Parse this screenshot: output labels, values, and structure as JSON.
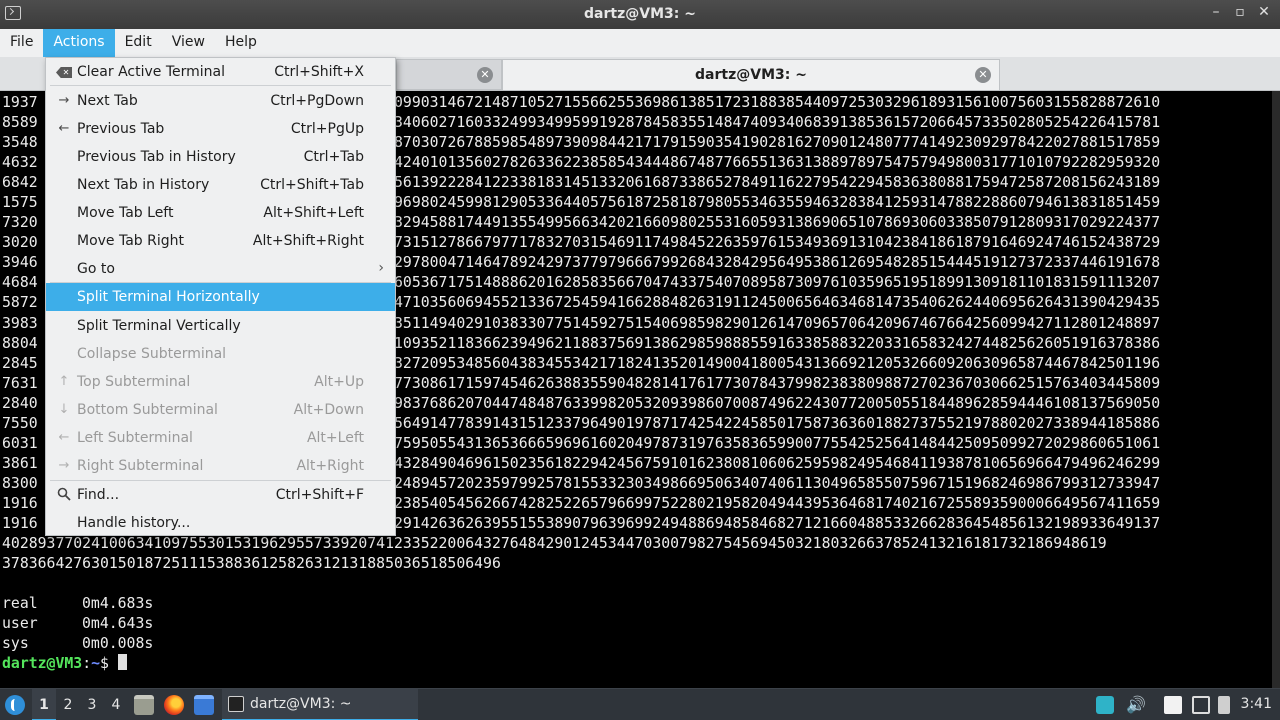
{
  "window": {
    "title": "dartz@VM3: ~",
    "buttons": [
      "–",
      "▫",
      "✕"
    ]
  },
  "menubar": {
    "items": [
      "File",
      "Actions",
      "Edit",
      "View",
      "Help"
    ],
    "active": "Actions"
  },
  "tabs": [
    {
      "label": "",
      "close": "✕"
    },
    {
      "label": "dartz@VM3: ~",
      "close": "✕"
    }
  ],
  "dropdown": {
    "items": [
      {
        "label": "Clear Active Terminal",
        "shortcut": "Ctrl+Shift+X",
        "icon": "clear-icon",
        "state": "normal"
      },
      {
        "label": "Next Tab",
        "shortcut": "Ctrl+PgDown",
        "icon": "arrow-right-icon",
        "state": "normal"
      },
      {
        "label": "Previous Tab",
        "shortcut": "Ctrl+PgUp",
        "icon": "arrow-left-icon",
        "state": "normal"
      },
      {
        "label": "Previous Tab in History",
        "shortcut": "Ctrl+Tab",
        "icon": "",
        "state": "normal"
      },
      {
        "label": "Next Tab in History",
        "shortcut": "Ctrl+Shift+Tab",
        "icon": "",
        "state": "normal"
      },
      {
        "label": "Move Tab Left",
        "shortcut": "Alt+Shift+Left",
        "icon": "",
        "state": "normal"
      },
      {
        "label": "Move Tab Right",
        "shortcut": "Alt+Shift+Right",
        "icon": "",
        "state": "normal"
      },
      {
        "label": "Go to",
        "shortcut": "",
        "icon": "",
        "state": "submenu"
      },
      {
        "label": "Split Terminal Horizontally",
        "shortcut": "",
        "icon": "",
        "state": "highlighted"
      },
      {
        "label": "Split Terminal Vertically",
        "shortcut": "",
        "icon": "",
        "state": "normal"
      },
      {
        "label": "Collapse Subterminal",
        "shortcut": "",
        "icon": "",
        "state": "disabled"
      },
      {
        "label": "Top Subterminal",
        "shortcut": "Alt+Up",
        "icon": "arrow-up-icon",
        "state": "disabled"
      },
      {
        "label": "Bottom Subterminal",
        "shortcut": "Alt+Down",
        "icon": "arrow-down-icon",
        "state": "disabled"
      },
      {
        "label": "Left Subterminal",
        "shortcut": "Alt+Left",
        "icon": "arrow-left-icon",
        "state": "disabled"
      },
      {
        "label": "Right Subterminal",
        "shortcut": "Alt+Right",
        "icon": "arrow-right-icon",
        "state": "disabled"
      },
      {
        "label": "Find...",
        "shortcut": "Ctrl+Shift+F",
        "icon": "search-icon",
        "state": "normal"
      },
      {
        "label": "Handle history...",
        "shortcut": "",
        "icon": "",
        "state": "normal"
      }
    ],
    "submenu_arrow": "›"
  },
  "terminal": {
    "left_digits": [
      "1937",
      "8589",
      "3548",
      "4632",
      "6842",
      "1575",
      "7320",
      "3020",
      "3946",
      "4684",
      "5872",
      "3983",
      "8804",
      "2845",
      "7631",
      "2840",
      "7550",
      "6031",
      "3861",
      "8300",
      "1916"
    ],
    "right_digits": [
      "09903146721487105271556625536986138517231883854409725303296189315610075603155828872610",
      "34060271603324993499599192878458355148474093406839138536157206645733502805254226415781",
      "87030726788598548973909844217179159035419028162709012480777414923092978422027881517859",
      "42401013560278263362238585434448674877665513631388978975475794980031771010792282959320",
      "56139222841223381831451332061687338652784911622795422945836380881759472587208156243189",
      "96980245998129053364405756187258187980553463559463283841259314788228860794613831851459",
      "32945881744913554995663420216609802553160593138690651078693060338507912809317029224377",
      "73151278667977178327031546911749845226359761534936913104238418618791646924746152438729",
      "29780047146478924297377979666799268432842956495386126954828515444519127372337446191678",
      "60536717514888620162858356670474337540708958730976103596519518991309181101831591113207",
      "47103560694552133672545941662884826319112450065646346814735406262440695626431390429435",
      "35114940291038330775145927515406985982901261470965706420967467664256099427112801248897",
      "10935211836623949621188375691386298598885591633858832203316583242744825626051916378386",
      "32720953485604383455342171824135201490041800543136692120532660920630965874467842501196",
      "77308617159745462638835590482814176177307843799823838098872702367030662515763403445809",
      "98376862070447484876339982053209398607008749622430772005055184489628594446108137569050",
      "56491477839143151233796490197871742542245850175873636018827375521978802027338944185886",
      "75950554313653666596961602049787319763583659900775542525641484425095099272029860651061",
      "43284904696150235618229424567591016238081060625959824954684119387810656966479496246299",
      "24894572023597992578155332303498669506340740611304965855075967151968246986799312733947",
      "23854054562667428252265796699752280219582049443953646817402167255893590006649567411659",
      "29142636263955155389079639699249488694858468271216604885332662836454856132198933649137"
    ],
    "full_lines": [
      "4028937702410063410975530153196295573392074123352200643276484290124534470300798275456945032180326637852413216181732186948619",
      "37836642763015018725111538836125826312131885036518506496"
    ],
    "time_labels": [
      "real",
      "user",
      "sys"
    ],
    "time_values": [
      "0m4.683s",
      "0m4.643s",
      "0m0.008s"
    ],
    "prompt_user": "dartz@VM3",
    "prompt_sep": ":",
    "prompt_path": "~",
    "prompt_symbol": "$"
  },
  "taskbar": {
    "workspaces": [
      "1",
      "2",
      "3",
      "4"
    ],
    "active_workspace": "1",
    "task_label": "dartz@VM3: ~",
    "clock": "3:41"
  },
  "colors": {
    "accent": "#3daee9",
    "prompt_user": "#54e55c",
    "prompt_path": "#6f8cff"
  }
}
